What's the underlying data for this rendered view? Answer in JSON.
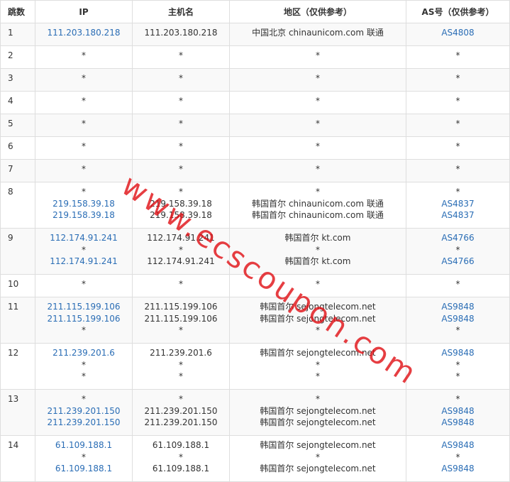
{
  "headers": {
    "hop": "跳数",
    "ip": "IP",
    "hostname": "主机名",
    "region": "地区（仅供参考）",
    "as": "AS号（仅供参考）"
  },
  "rows": [
    {
      "hop": "1",
      "ip": [
        "111.203.180.218"
      ],
      "host": [
        "111.203.180.218"
      ],
      "region": [
        "中国北京 chinaunicom.com 联通"
      ],
      "as": [
        "AS4808"
      ]
    },
    {
      "hop": "2",
      "ip": [
        "*"
      ],
      "host": [
        "*"
      ],
      "region": [
        "*"
      ],
      "as": [
        "*"
      ]
    },
    {
      "hop": "3",
      "ip": [
        "*"
      ],
      "host": [
        "*"
      ],
      "region": [
        "*"
      ],
      "as": [
        "*"
      ]
    },
    {
      "hop": "4",
      "ip": [
        "*"
      ],
      "host": [
        "*"
      ],
      "region": [
        "*"
      ],
      "as": [
        "*"
      ]
    },
    {
      "hop": "5",
      "ip": [
        "*"
      ],
      "host": [
        "*"
      ],
      "region": [
        "*"
      ],
      "as": [
        "*"
      ]
    },
    {
      "hop": "6",
      "ip": [
        "*"
      ],
      "host": [
        "*"
      ],
      "region": [
        "*"
      ],
      "as": [
        "*"
      ]
    },
    {
      "hop": "7",
      "ip": [
        "*"
      ],
      "host": [
        "*"
      ],
      "region": [
        "*"
      ],
      "as": [
        "*"
      ]
    },
    {
      "hop": "8",
      "ip": [
        "*",
        "219.158.39.18",
        "219.158.39.18"
      ],
      "host": [
        "*",
        "219.158.39.18",
        "219.158.39.18"
      ],
      "region": [
        "*",
        "韩国首尔 chinaunicom.com 联通",
        "韩国首尔 chinaunicom.com 联通"
      ],
      "as": [
        "*",
        "AS4837",
        "AS4837"
      ]
    },
    {
      "hop": "9",
      "ip": [
        "112.174.91.241",
        "*",
        "112.174.91.241"
      ],
      "host": [
        "112.174.91.241",
        "*",
        "112.174.91.241"
      ],
      "region": [
        "韩国首尔 kt.com",
        "*",
        "韩国首尔 kt.com"
      ],
      "as": [
        "AS4766",
        "*",
        "AS4766"
      ]
    },
    {
      "hop": "10",
      "ip": [
        "*"
      ],
      "host": [
        "*"
      ],
      "region": [
        "*"
      ],
      "as": [
        "*"
      ]
    },
    {
      "hop": "11",
      "ip": [
        "211.115.199.106",
        "211.115.199.106",
        "*"
      ],
      "host": [
        "211.115.199.106",
        "211.115.199.106",
        "*"
      ],
      "region": [
        "韩国首尔 sejongtelecom.net",
        "韩国首尔 sejongtelecom.net",
        "*"
      ],
      "as": [
        "AS9848",
        "AS9848",
        "*"
      ]
    },
    {
      "hop": "12",
      "ip": [
        "211.239.201.6",
        "*",
        "*"
      ],
      "host": [
        "211.239.201.6",
        "*",
        "*"
      ],
      "region": [
        "韩国首尔 sejongtelecom.net",
        "*",
        "*"
      ],
      "as": [
        "AS9848",
        "*",
        "*"
      ]
    },
    {
      "hop": "13",
      "ip": [
        "*",
        "211.239.201.150",
        "211.239.201.150"
      ],
      "host": [
        "*",
        "211.239.201.150",
        "211.239.201.150"
      ],
      "region": [
        "*",
        "韩国首尔 sejongtelecom.net",
        "韩国首尔 sejongtelecom.net"
      ],
      "as": [
        "*",
        "AS9848",
        "AS9848"
      ]
    },
    {
      "hop": "14",
      "ip": [
        "61.109.188.1",
        "*",
        "61.109.188.1"
      ],
      "host": [
        "61.109.188.1",
        "*",
        "61.109.188.1"
      ],
      "region": [
        "韩国首尔 sejongtelecom.net",
        "*",
        "韩国首尔 sejongtelecom.net"
      ],
      "as": [
        "AS9848",
        "*",
        "AS9848"
      ]
    }
  ],
  "watermark": "www.ecscoupon.com",
  "colors": {
    "link": "#2a6db5",
    "watermark": "#e11419",
    "border": "#dedede",
    "stripe": "#f9f9f9"
  }
}
